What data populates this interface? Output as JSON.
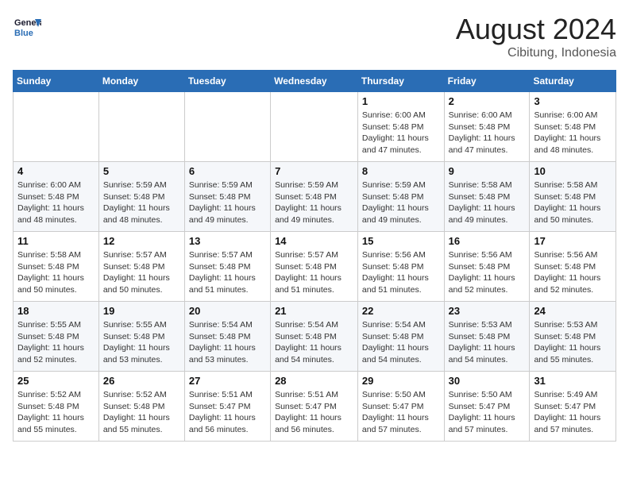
{
  "header": {
    "logo_line1": "General",
    "logo_line2": "Blue",
    "title": "August 2024",
    "subtitle": "Cibitung, Indonesia"
  },
  "weekdays": [
    "Sunday",
    "Monday",
    "Tuesday",
    "Wednesday",
    "Thursday",
    "Friday",
    "Saturday"
  ],
  "weeks": [
    [
      {
        "day": "",
        "info": ""
      },
      {
        "day": "",
        "info": ""
      },
      {
        "day": "",
        "info": ""
      },
      {
        "day": "",
        "info": ""
      },
      {
        "day": "1",
        "info": "Sunrise: 6:00 AM\nSunset: 5:48 PM\nDaylight: 11 hours\nand 47 minutes."
      },
      {
        "day": "2",
        "info": "Sunrise: 6:00 AM\nSunset: 5:48 PM\nDaylight: 11 hours\nand 47 minutes."
      },
      {
        "day": "3",
        "info": "Sunrise: 6:00 AM\nSunset: 5:48 PM\nDaylight: 11 hours\nand 48 minutes."
      }
    ],
    [
      {
        "day": "4",
        "info": "Sunrise: 6:00 AM\nSunset: 5:48 PM\nDaylight: 11 hours\nand 48 minutes."
      },
      {
        "day": "5",
        "info": "Sunrise: 5:59 AM\nSunset: 5:48 PM\nDaylight: 11 hours\nand 48 minutes."
      },
      {
        "day": "6",
        "info": "Sunrise: 5:59 AM\nSunset: 5:48 PM\nDaylight: 11 hours\nand 49 minutes."
      },
      {
        "day": "7",
        "info": "Sunrise: 5:59 AM\nSunset: 5:48 PM\nDaylight: 11 hours\nand 49 minutes."
      },
      {
        "day": "8",
        "info": "Sunrise: 5:59 AM\nSunset: 5:48 PM\nDaylight: 11 hours\nand 49 minutes."
      },
      {
        "day": "9",
        "info": "Sunrise: 5:58 AM\nSunset: 5:48 PM\nDaylight: 11 hours\nand 49 minutes."
      },
      {
        "day": "10",
        "info": "Sunrise: 5:58 AM\nSunset: 5:48 PM\nDaylight: 11 hours\nand 50 minutes."
      }
    ],
    [
      {
        "day": "11",
        "info": "Sunrise: 5:58 AM\nSunset: 5:48 PM\nDaylight: 11 hours\nand 50 minutes."
      },
      {
        "day": "12",
        "info": "Sunrise: 5:57 AM\nSunset: 5:48 PM\nDaylight: 11 hours\nand 50 minutes."
      },
      {
        "day": "13",
        "info": "Sunrise: 5:57 AM\nSunset: 5:48 PM\nDaylight: 11 hours\nand 51 minutes."
      },
      {
        "day": "14",
        "info": "Sunrise: 5:57 AM\nSunset: 5:48 PM\nDaylight: 11 hours\nand 51 minutes."
      },
      {
        "day": "15",
        "info": "Sunrise: 5:56 AM\nSunset: 5:48 PM\nDaylight: 11 hours\nand 51 minutes."
      },
      {
        "day": "16",
        "info": "Sunrise: 5:56 AM\nSunset: 5:48 PM\nDaylight: 11 hours\nand 52 minutes."
      },
      {
        "day": "17",
        "info": "Sunrise: 5:56 AM\nSunset: 5:48 PM\nDaylight: 11 hours\nand 52 minutes."
      }
    ],
    [
      {
        "day": "18",
        "info": "Sunrise: 5:55 AM\nSunset: 5:48 PM\nDaylight: 11 hours\nand 52 minutes."
      },
      {
        "day": "19",
        "info": "Sunrise: 5:55 AM\nSunset: 5:48 PM\nDaylight: 11 hours\nand 53 minutes."
      },
      {
        "day": "20",
        "info": "Sunrise: 5:54 AM\nSunset: 5:48 PM\nDaylight: 11 hours\nand 53 minutes."
      },
      {
        "day": "21",
        "info": "Sunrise: 5:54 AM\nSunset: 5:48 PM\nDaylight: 11 hours\nand 54 minutes."
      },
      {
        "day": "22",
        "info": "Sunrise: 5:54 AM\nSunset: 5:48 PM\nDaylight: 11 hours\nand 54 minutes."
      },
      {
        "day": "23",
        "info": "Sunrise: 5:53 AM\nSunset: 5:48 PM\nDaylight: 11 hours\nand 54 minutes."
      },
      {
        "day": "24",
        "info": "Sunrise: 5:53 AM\nSunset: 5:48 PM\nDaylight: 11 hours\nand 55 minutes."
      }
    ],
    [
      {
        "day": "25",
        "info": "Sunrise: 5:52 AM\nSunset: 5:48 PM\nDaylight: 11 hours\nand 55 minutes."
      },
      {
        "day": "26",
        "info": "Sunrise: 5:52 AM\nSunset: 5:48 PM\nDaylight: 11 hours\nand 55 minutes."
      },
      {
        "day": "27",
        "info": "Sunrise: 5:51 AM\nSunset: 5:47 PM\nDaylight: 11 hours\nand 56 minutes."
      },
      {
        "day": "28",
        "info": "Sunrise: 5:51 AM\nSunset: 5:47 PM\nDaylight: 11 hours\nand 56 minutes."
      },
      {
        "day": "29",
        "info": "Sunrise: 5:50 AM\nSunset: 5:47 PM\nDaylight: 11 hours\nand 57 minutes."
      },
      {
        "day": "30",
        "info": "Sunrise: 5:50 AM\nSunset: 5:47 PM\nDaylight: 11 hours\nand 57 minutes."
      },
      {
        "day": "31",
        "info": "Sunrise: 5:49 AM\nSunset: 5:47 PM\nDaylight: 11 hours\nand 57 minutes."
      }
    ]
  ]
}
